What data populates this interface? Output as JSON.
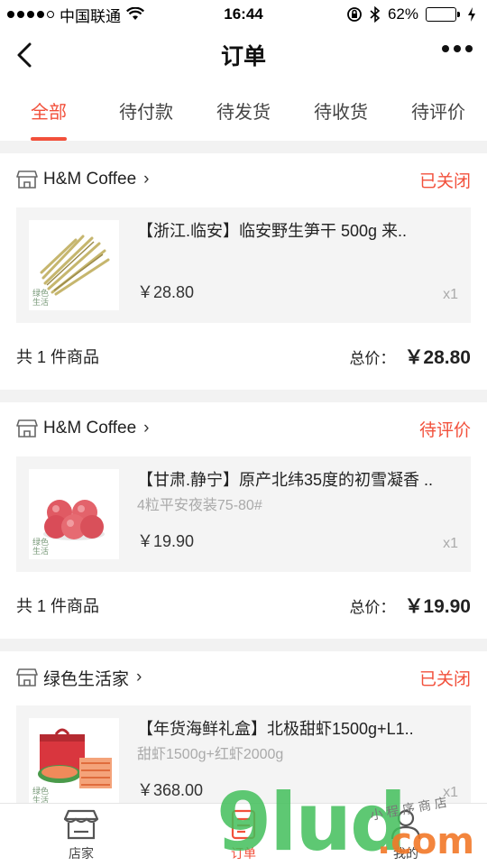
{
  "status_bar": {
    "carrier": "中国联通",
    "time": "16:44",
    "battery": "62%",
    "battery_level": 0.62
  },
  "nav": {
    "title": "订单"
  },
  "tabs": [
    {
      "label": "全部",
      "active": true
    },
    {
      "label": "待付款",
      "active": false
    },
    {
      "label": "待发货",
      "active": false
    },
    {
      "label": "待收货",
      "active": false
    },
    {
      "label": "待评价",
      "active": false
    }
  ],
  "orders": [
    {
      "shop": "H&M Coffee",
      "status": "已关闭",
      "product_name": "【浙江.临安】临安野生笋干 500g 来..",
      "product_spec": "",
      "price": "￥28.80",
      "qty": "x1",
      "thumb_logo": "绿色生活",
      "count_text": "共 1 件商品",
      "total_label": "总价：",
      "total_value": "￥28.80"
    },
    {
      "shop": "H&M Coffee",
      "status": "待评价",
      "product_name": "【甘肃.静宁】原产北纬35度的初雪凝香 ..",
      "product_spec": "4粒平安夜装75-80#",
      "price": "￥19.90",
      "qty": "x1",
      "thumb_logo": "绿色生活",
      "count_text": "共 1 件商品",
      "total_label": "总价：",
      "total_value": "￥19.90"
    },
    {
      "shop": "绿色生活家",
      "status": "已关闭",
      "product_name": "【年货海鲜礼盒】北极甜虾1500g+L1..",
      "product_spec": "甜虾1500g+红虾2000g",
      "price": "￥368.00",
      "qty": "x1",
      "thumb_logo": "绿色生活"
    }
  ],
  "tab_bar": [
    {
      "label": "店家",
      "icon": "store-icon",
      "active": false
    },
    {
      "label": "订单",
      "icon": "order-icon",
      "active": true
    },
    {
      "label": "我的",
      "icon": "profile-icon",
      "active": false
    }
  ],
  "watermark": {
    "main": "9lud",
    "com": ".com",
    "sub": "小程序商店"
  },
  "colors": {
    "accent": "#f2503b",
    "battery": "#4cd964",
    "watermark_green": "#42be5a"
  }
}
